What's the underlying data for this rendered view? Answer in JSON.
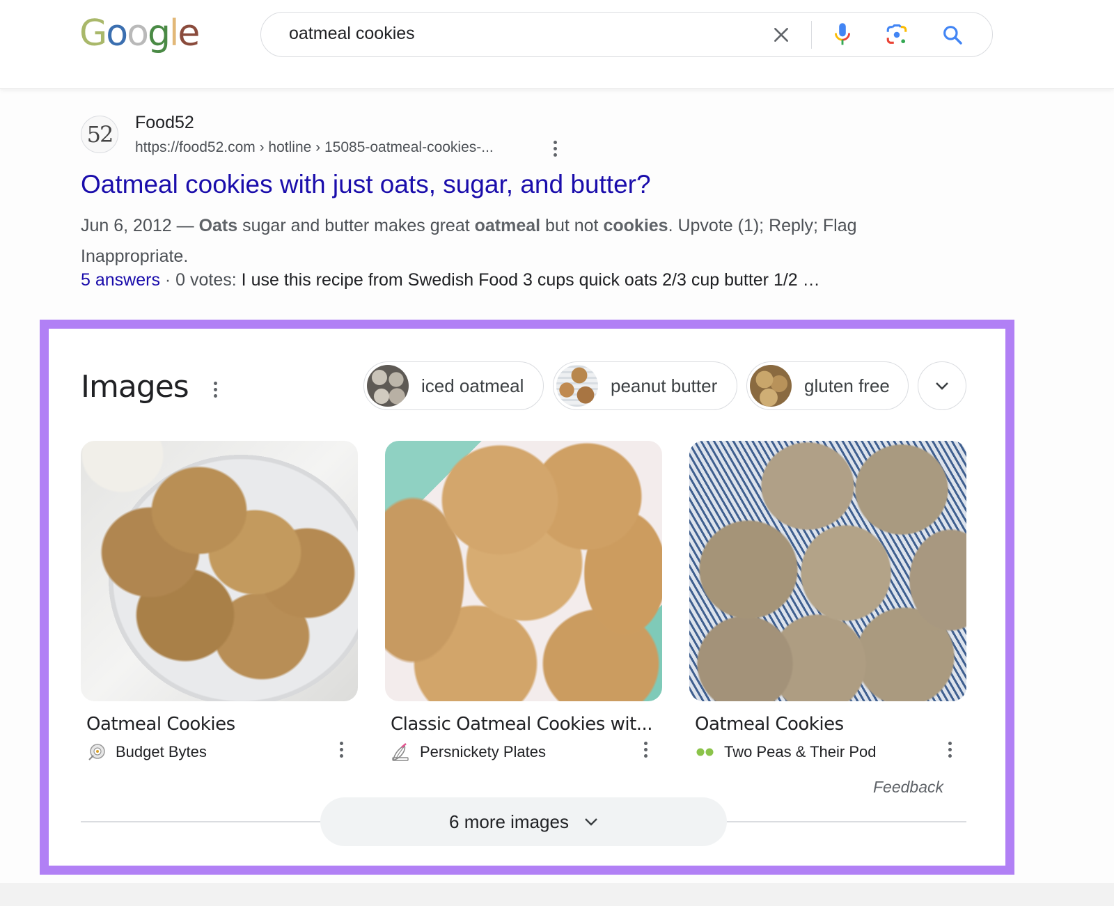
{
  "header": {
    "logo_letters": [
      "G",
      "o",
      "o",
      "g",
      "l",
      "e"
    ],
    "logo_colors": [
      "#a9b86a",
      "#3b6fb0",
      "#b9b9b9",
      "#4a8a45",
      "#e2b878",
      "#8a4b3c"
    ],
    "search": {
      "value": "oatmeal cookies",
      "clear_icon": "close-icon",
      "voice_icon": "microphone-icon",
      "lens_icon": "camera-lens-icon",
      "search_icon": "magnifier-icon"
    }
  },
  "result": {
    "favicon_text": "52",
    "site_name": "Food52",
    "url": "https://food52.com › hotline › 15085-oatmeal-cookies-...",
    "title": "Oatmeal cookies with just oats, sugar, and butter?",
    "snippet": {
      "date": "Jun 6, 2012 — ",
      "parts": [
        {
          "text": "Oats",
          "bold": true
        },
        {
          "text": " sugar and butter makes great ",
          "bold": false
        },
        {
          "text": "oatmeal",
          "bold": true
        },
        {
          "text": " but not ",
          "bold": false
        },
        {
          "text": "cookies",
          "bold": true
        },
        {
          "text": ". Upvote (1); Reply; Flag Inappropriate.",
          "bold": false
        }
      ]
    },
    "answers_link": "5 answers",
    "votes": " · 0 votes: ",
    "answer_preview": "I use this recipe from Swedish Food 3 cups quick oats 2/3 cup butter 1/2 …"
  },
  "images_section": {
    "title": "Images",
    "highlight_color": "#b180f5",
    "chips": [
      {
        "label": "iced oatmeal"
      },
      {
        "label": "peanut butter"
      },
      {
        "label": "gluten free"
      }
    ],
    "cards": [
      {
        "title": "Oatmeal Cookies",
        "source": "Budget Bytes",
        "source_icon": "budget-bytes-logo-icon"
      },
      {
        "title": "Classic Oatmeal Cookies wit...",
        "source": "Persnickety Plates",
        "source_icon": "whisk-logo-icon"
      },
      {
        "title": "Oatmeal Cookies",
        "source": "Two Peas & Their Pod",
        "source_icon": "two-peas-logo-icon"
      }
    ],
    "feedback": "Feedback",
    "more_button": "6 more images"
  }
}
